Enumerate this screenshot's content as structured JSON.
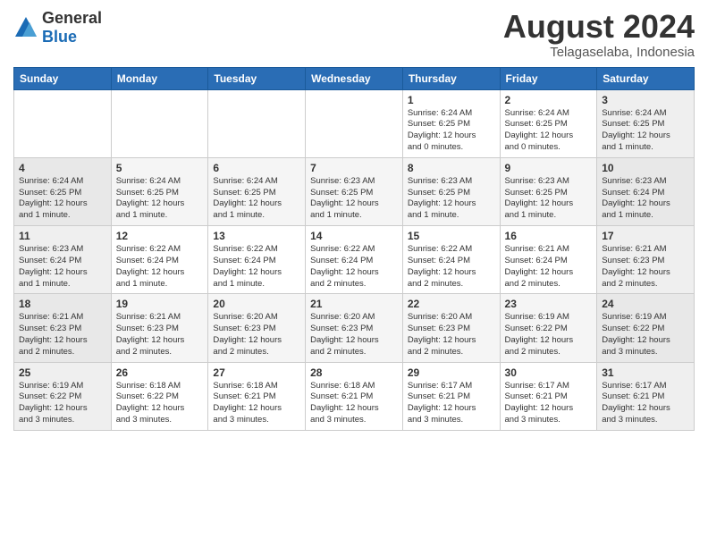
{
  "logo": {
    "general": "General",
    "blue": "Blue"
  },
  "header": {
    "title": "August 2024",
    "subtitle": "Telagaselaba, Indonesia"
  },
  "weekdays": [
    "Sunday",
    "Monday",
    "Tuesday",
    "Wednesday",
    "Thursday",
    "Friday",
    "Saturday"
  ],
  "weeks": [
    [
      {
        "day": "",
        "info": ""
      },
      {
        "day": "",
        "info": ""
      },
      {
        "day": "",
        "info": ""
      },
      {
        "day": "",
        "info": ""
      },
      {
        "day": "1",
        "info": "Sunrise: 6:24 AM\nSunset: 6:25 PM\nDaylight: 12 hours\nand 0 minutes."
      },
      {
        "day": "2",
        "info": "Sunrise: 6:24 AM\nSunset: 6:25 PM\nDaylight: 12 hours\nand 0 minutes."
      },
      {
        "day": "3",
        "info": "Sunrise: 6:24 AM\nSunset: 6:25 PM\nDaylight: 12 hours\nand 1 minute."
      }
    ],
    [
      {
        "day": "4",
        "info": "Sunrise: 6:24 AM\nSunset: 6:25 PM\nDaylight: 12 hours\nand 1 minute."
      },
      {
        "day": "5",
        "info": "Sunrise: 6:24 AM\nSunset: 6:25 PM\nDaylight: 12 hours\nand 1 minute."
      },
      {
        "day": "6",
        "info": "Sunrise: 6:24 AM\nSunset: 6:25 PM\nDaylight: 12 hours\nand 1 minute."
      },
      {
        "day": "7",
        "info": "Sunrise: 6:23 AM\nSunset: 6:25 PM\nDaylight: 12 hours\nand 1 minute."
      },
      {
        "day": "8",
        "info": "Sunrise: 6:23 AM\nSunset: 6:25 PM\nDaylight: 12 hours\nand 1 minute."
      },
      {
        "day": "9",
        "info": "Sunrise: 6:23 AM\nSunset: 6:25 PM\nDaylight: 12 hours\nand 1 minute."
      },
      {
        "day": "10",
        "info": "Sunrise: 6:23 AM\nSunset: 6:24 PM\nDaylight: 12 hours\nand 1 minute."
      }
    ],
    [
      {
        "day": "11",
        "info": "Sunrise: 6:23 AM\nSunset: 6:24 PM\nDaylight: 12 hours\nand 1 minute."
      },
      {
        "day": "12",
        "info": "Sunrise: 6:22 AM\nSunset: 6:24 PM\nDaylight: 12 hours\nand 1 minute."
      },
      {
        "day": "13",
        "info": "Sunrise: 6:22 AM\nSunset: 6:24 PM\nDaylight: 12 hours\nand 1 minute."
      },
      {
        "day": "14",
        "info": "Sunrise: 6:22 AM\nSunset: 6:24 PM\nDaylight: 12 hours\nand 2 minutes."
      },
      {
        "day": "15",
        "info": "Sunrise: 6:22 AM\nSunset: 6:24 PM\nDaylight: 12 hours\nand 2 minutes."
      },
      {
        "day": "16",
        "info": "Sunrise: 6:21 AM\nSunset: 6:24 PM\nDaylight: 12 hours\nand 2 minutes."
      },
      {
        "day": "17",
        "info": "Sunrise: 6:21 AM\nSunset: 6:23 PM\nDaylight: 12 hours\nand 2 minutes."
      }
    ],
    [
      {
        "day": "18",
        "info": "Sunrise: 6:21 AM\nSunset: 6:23 PM\nDaylight: 12 hours\nand 2 minutes."
      },
      {
        "day": "19",
        "info": "Sunrise: 6:21 AM\nSunset: 6:23 PM\nDaylight: 12 hours\nand 2 minutes."
      },
      {
        "day": "20",
        "info": "Sunrise: 6:20 AM\nSunset: 6:23 PM\nDaylight: 12 hours\nand 2 minutes."
      },
      {
        "day": "21",
        "info": "Sunrise: 6:20 AM\nSunset: 6:23 PM\nDaylight: 12 hours\nand 2 minutes."
      },
      {
        "day": "22",
        "info": "Sunrise: 6:20 AM\nSunset: 6:23 PM\nDaylight: 12 hours\nand 2 minutes."
      },
      {
        "day": "23",
        "info": "Sunrise: 6:19 AM\nSunset: 6:22 PM\nDaylight: 12 hours\nand 2 minutes."
      },
      {
        "day": "24",
        "info": "Sunrise: 6:19 AM\nSunset: 6:22 PM\nDaylight: 12 hours\nand 3 minutes."
      }
    ],
    [
      {
        "day": "25",
        "info": "Sunrise: 6:19 AM\nSunset: 6:22 PM\nDaylight: 12 hours\nand 3 minutes."
      },
      {
        "day": "26",
        "info": "Sunrise: 6:18 AM\nSunset: 6:22 PM\nDaylight: 12 hours\nand 3 minutes."
      },
      {
        "day": "27",
        "info": "Sunrise: 6:18 AM\nSunset: 6:21 PM\nDaylight: 12 hours\nand 3 minutes."
      },
      {
        "day": "28",
        "info": "Sunrise: 6:18 AM\nSunset: 6:21 PM\nDaylight: 12 hours\nand 3 minutes."
      },
      {
        "day": "29",
        "info": "Sunrise: 6:17 AM\nSunset: 6:21 PM\nDaylight: 12 hours\nand 3 minutes."
      },
      {
        "day": "30",
        "info": "Sunrise: 6:17 AM\nSunset: 6:21 PM\nDaylight: 12 hours\nand 3 minutes."
      },
      {
        "day": "31",
        "info": "Sunrise: 6:17 AM\nSunset: 6:21 PM\nDaylight: 12 hours\nand 3 minutes."
      }
    ]
  ]
}
